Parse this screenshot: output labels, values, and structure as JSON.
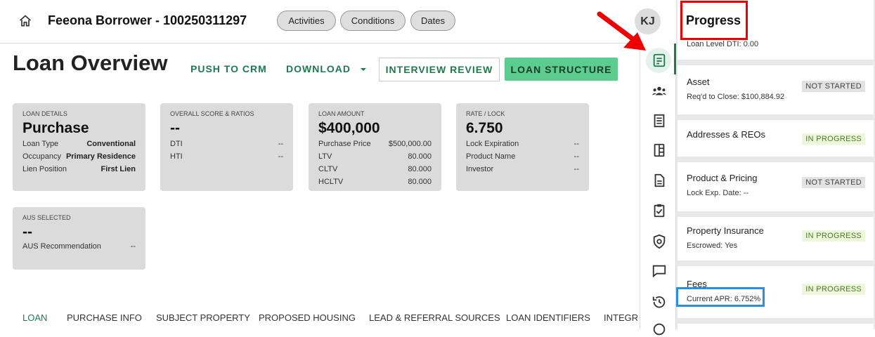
{
  "header": {
    "title": "Feeona Borrower - 100250311297",
    "pills": [
      "Activities",
      "Conditions",
      "Dates"
    ],
    "avatar": "KJ"
  },
  "page": {
    "title": "Loan Overview",
    "push_to_crm": "PUSH TO CRM",
    "download": "DOWNLOAD",
    "interview_review": "INTERVIEW REVIEW",
    "loan_structure": "LOAN STRUCTURE"
  },
  "cards": {
    "loan_details": {
      "label": "LOAN DETAILS",
      "main": "Purchase",
      "rows": [
        {
          "k": "Loan Type",
          "v": "Conventional"
        },
        {
          "k": "Occupancy",
          "v": "Primary Residence"
        },
        {
          "k": "Lien Position",
          "v": "First Lien"
        }
      ]
    },
    "score": {
      "label": "OVERALL SCORE & RATIOS",
      "main": "--",
      "rows": [
        {
          "k": "DTI",
          "v": "--"
        },
        {
          "k": "HTI",
          "v": "--"
        }
      ]
    },
    "amount": {
      "label": "LOAN AMOUNT",
      "main": "$400,000",
      "rows": [
        {
          "k": "Purchase Price",
          "v": "$500,000.00"
        },
        {
          "k": "LTV",
          "v": "80.000"
        },
        {
          "k": "CLTV",
          "v": "80.000"
        },
        {
          "k": "HCLTV",
          "v": "80.000"
        }
      ]
    },
    "rate": {
      "label": "RATE / LOCK",
      "main": "6.750",
      "rows": [
        {
          "k": "Lock Expiration",
          "v": "--"
        },
        {
          "k": "Product Name",
          "v": "--"
        },
        {
          "k": "Investor",
          "v": "--"
        }
      ]
    },
    "aus": {
      "label": "AUS SELECTED",
      "main": "--",
      "rows": [
        {
          "k": "AUS Recommendation",
          "v": "--"
        }
      ]
    }
  },
  "tabs": [
    "LOAN",
    "PURCHASE INFO",
    "SUBJECT PROPERTY",
    "PROPOSED HOUSING",
    "LEAD & REFERRAL SOURCES",
    "LOAN IDENTIFIERS",
    "INTEGR"
  ],
  "progress": {
    "title": "Progress",
    "clipped_text": "Loan Level DTI: 0.00",
    "items": [
      {
        "title": "Asset",
        "sub": "Req'd to Close: $100,884.92",
        "status": "NOT STARTED"
      },
      {
        "title": "Addresses & REOs",
        "sub": "",
        "status": "IN PROGRESS"
      },
      {
        "title": "Product & Pricing",
        "sub": "Lock Exp. Date: --",
        "status": "NOT STARTED"
      },
      {
        "title": "Property Insurance",
        "sub": "Escrowed: Yes",
        "status": "IN PROGRESS"
      },
      {
        "title": "Fees",
        "sub": "Current APR: 6.752%",
        "status": "IN PROGRESS"
      }
    ]
  },
  "colors": {
    "accent_green": "#1e7a4c",
    "button_green": "#5ccd8e",
    "annotation_red": "#e00000",
    "annotation_blue": "#2a8fe0"
  }
}
